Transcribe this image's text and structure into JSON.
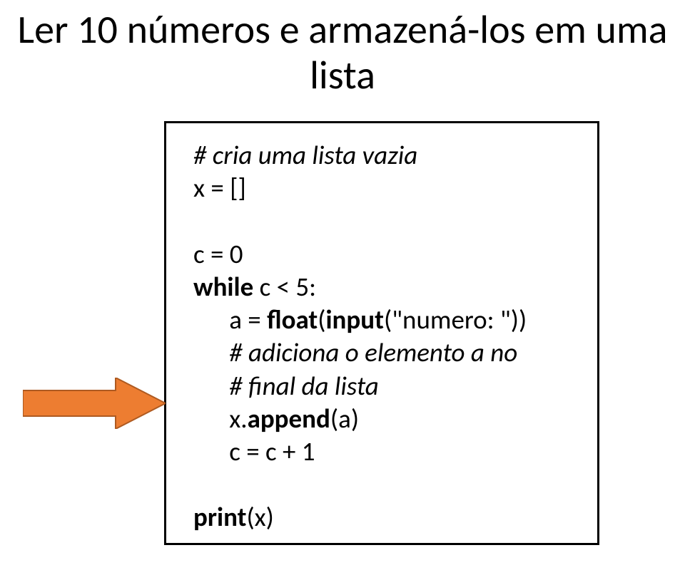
{
  "title": "Ler 10 números e armazená-los em uma lista",
  "code": {
    "comment1": "# cria uma lista vazia",
    "line1": "x = []",
    "line2": "c = 0",
    "while_kw": "while",
    "while_cond": " c < 5:",
    "float_kw": "float",
    "input_kw": "input",
    "line3_prefix": "      a = ",
    "line3_paren_open": "(",
    "line3_arg": "(\"numero: \"))",
    "comment2": "      # adiciona o elemento a no",
    "comment3": "      # final da lista",
    "append_prefix": "      x.",
    "append_kw": "append",
    "append_suffix": "(a)",
    "line4": "      c = c + 1",
    "print_kw": "print",
    "print_suffix": "(x)"
  }
}
